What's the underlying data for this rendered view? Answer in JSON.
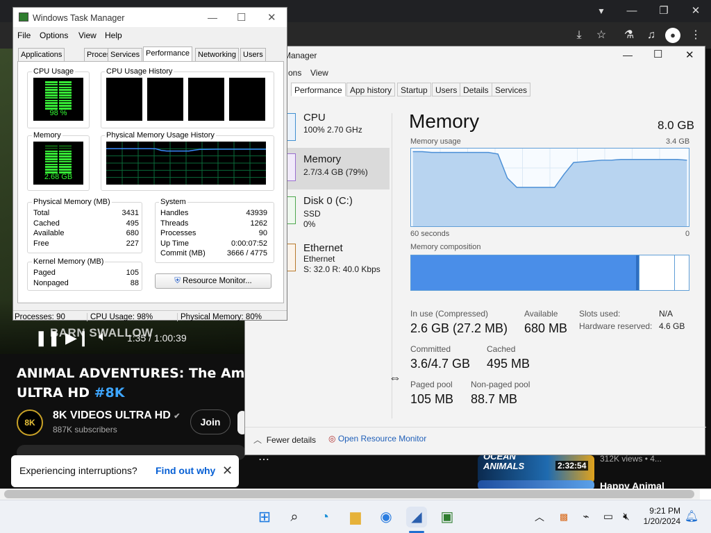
{
  "browser": {
    "window_controls": [
      "▼",
      "—",
      "❐",
      "✕"
    ],
    "toolbar_icons": [
      "download-icon",
      "star-icon",
      "labs-icon",
      "media-icon",
      "profile-icon",
      "menu-icon"
    ]
  },
  "youtube": {
    "overlay_text": "BARN SWALLOW",
    "time": "1:35 / 1:00:39",
    "title_main": "ANIMAL ADVENTURES: The Amazing",
    "title_line2": "ULTRA HD",
    "title_hashtag": "#8K",
    "channel_logo": "8K",
    "channel_name": "8K VIDEOS ULTRA HD",
    "verified_icon": "✔",
    "subscribers": "887K subscribers",
    "join_label": "Join",
    "more_label": "⋯",
    "toast_text": "Experiencing interruptions?",
    "toast_link": "Find out why",
    "toast_close": "✕",
    "rec1_title_a": "OCEAN",
    "rec1_title_b": "ANIMALS",
    "rec1_duration": "2:32:54",
    "rec1_meta": "312K views • 4...",
    "rec2_title": "Happy Animal"
  },
  "w11tm": {
    "title": "Manager",
    "min": "—",
    "max": "☐",
    "close": "✕",
    "menu": [
      "ons",
      "View"
    ],
    "tabs": [
      "Performance",
      "App history",
      "Startup",
      "Users",
      "Details",
      "Services"
    ],
    "sidebar": [
      {
        "name": "CPU",
        "sub": "100%  2.70 GHz",
        "sub2": ""
      },
      {
        "name": "Memory",
        "sub": "2.7/3.4 GB (79%)",
        "sub2": ""
      },
      {
        "name": "Disk 0 (C:)",
        "sub": "SSD",
        "sub2": "0%"
      },
      {
        "name": "Ethernet",
        "sub": "Ethernet",
        "sub2": "S: 32.0  R: 40.0 Kbps"
      }
    ],
    "heading": "Memory",
    "total": "8.0 GB",
    "usage_label": "Memory usage",
    "usage_max": "3.4 GB",
    "axis_left": "60 seconds",
    "axis_right": "0",
    "composition_label": "Memory composition",
    "composition": {
      "in_use_fraction": 0.81,
      "modified_fraction": 0.01,
      "standby_fraction": 0.13,
      "free_fraction": 0.05
    },
    "stats": {
      "in_use_label": "In use (Compressed)",
      "in_use_value": "2.6 GB (27.2 MB)",
      "available_label": "Available",
      "available_value": "680 MB",
      "slots_label": "Slots used:",
      "slots_value": "N/A",
      "hw_label": "Hardware reserved:",
      "hw_value": "4.6 GB",
      "committed_label": "Committed",
      "committed_value": "3.6/4.7 GB",
      "cached_label": "Cached",
      "cached_value": "495 MB",
      "paged_label": "Paged pool",
      "paged_value": "105 MB",
      "nonpaged_label": "Non-paged pool",
      "nonpaged_value": "88.7 MB"
    },
    "fewer_details": "Fewer details",
    "open_rm": "Open Resource Monitor"
  },
  "w7tm": {
    "title": "Windows Task Manager",
    "menu": [
      "File",
      "Options",
      "View",
      "Help"
    ],
    "tabs": [
      "Applications",
      "Processes",
      "Services",
      "Performance",
      "Networking",
      "Users"
    ],
    "cpu_usage_title": "CPU Usage",
    "cpu_usage_value": "98 %",
    "cpu_usage_fraction": 0.98,
    "cpu_history_title": "CPU Usage History",
    "memory_title": "Memory",
    "memory_value": "2.68 GB",
    "memory_fraction": 0.8,
    "pm_history_title": "Physical Memory Usage History",
    "phys_title": "Physical Memory (MB)",
    "phys": [
      [
        "Total",
        "3431"
      ],
      [
        "Cached",
        "495"
      ],
      [
        "Available",
        "680"
      ],
      [
        "Free",
        "227"
      ]
    ],
    "sys_title": "System",
    "sys": [
      [
        "Handles",
        "43939"
      ],
      [
        "Threads",
        "1262"
      ],
      [
        "Processes",
        "90"
      ],
      [
        "Up Time",
        "0:00:07:52"
      ],
      [
        "Commit (MB)",
        "3666 / 4775"
      ]
    ],
    "kernel_title": "Kernel Memory (MB)",
    "kernel": [
      [
        "Paged",
        "105"
      ],
      [
        "Nonpaged",
        "88"
      ]
    ],
    "resource_monitor": "Resource Monitor...",
    "status": [
      "Processes: 90",
      "CPU Usage: 98%",
      "Physical Memory: 80%"
    ]
  },
  "taskbar": {
    "time": "9:21 PM",
    "date": "1/20/2024",
    "apps": [
      "windows-start-icon",
      "search-icon",
      "edge-icon",
      "file-explorer-icon",
      "chrome-icon",
      "task-manager-icon",
      "task-manager-classic-icon"
    ],
    "tray": [
      "chevron-up-icon",
      "tray-app-icon",
      "network-icon",
      "display-icon",
      "volume-muted-icon",
      "notification-bell-icon"
    ]
  },
  "memory_history": {
    "note_series": "Memory usage (fraction of max)",
    "values": [
      0.96,
      0.96,
      0.95,
      0.95,
      0.95,
      0.95,
      0.95,
      0.95,
      0.95,
      0.93,
      0.62,
      0.5,
      0.5,
      0.5,
      0.5,
      0.5,
      0.67,
      0.82,
      0.83,
      0.84,
      0.85,
      0.85,
      0.86,
      0.86,
      0.86,
      0.86,
      0.86,
      0.86,
      0.86,
      0.85
    ]
  }
}
